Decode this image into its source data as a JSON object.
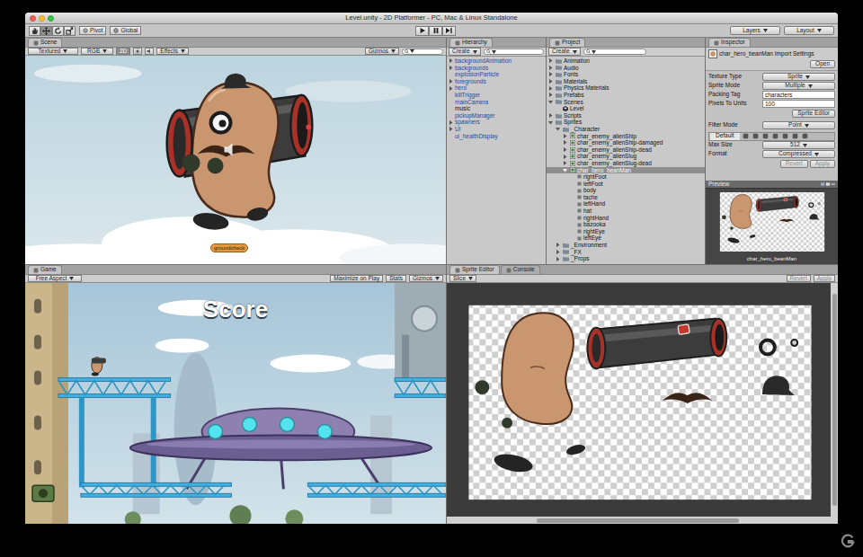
{
  "window": {
    "title": "Level.unity - 2D Platformer - PC, Mac & Linux Standalone"
  },
  "toolbar": {
    "tools": [
      {
        "kind": "hand",
        "selected": false
      },
      {
        "kind": "move",
        "selected": true
      },
      {
        "kind": "rotate",
        "selected": false
      },
      {
        "kind": "scale",
        "selected": false
      }
    ],
    "pivot": "Pivot",
    "global": "Global",
    "layers": "Layers",
    "layout": "Layout"
  },
  "scene": {
    "tab": {
      "label": "Scene",
      "selected": true
    },
    "shading": "Textured",
    "channel": "RGB",
    "mode2d": {
      "label": "2D",
      "on": true
    },
    "effects": "Effects",
    "gizmos": "Gizmos",
    "label": "groundcheck"
  },
  "hierarchy": {
    "tab": {
      "label": "Hierarchy",
      "selected": true
    },
    "create": "Create",
    "items": [
      {
        "name": "backgroundAnimation",
        "prefab": true,
        "expandable": true,
        "expanded": false
      },
      {
        "name": "backgrounds",
        "prefab": true,
        "expandable": true,
        "expanded": false
      },
      {
        "name": "explosionParticle",
        "prefab": true,
        "expandable": false,
        "expanded": false
      },
      {
        "name": "foregrounds",
        "prefab": true,
        "expandable": true,
        "expanded": false
      },
      {
        "name": "hero",
        "prefab": true,
        "expandable": true,
        "expanded": false
      },
      {
        "name": "killTrigger",
        "prefab": true,
        "expandable": false,
        "expanded": false
      },
      {
        "name": "mainCamera",
        "prefab": true,
        "expandable": false,
        "expanded": false
      },
      {
        "name": "music",
        "prefab": false,
        "expandable": false,
        "expanded": false
      },
      {
        "name": "pickupManager",
        "prefab": true,
        "expandable": false,
        "expanded": false
      },
      {
        "name": "spawners",
        "prefab": true,
        "expandable": true,
        "expanded": false
      },
      {
        "name": "UI",
        "prefab": true,
        "expandable": true,
        "expanded": false
      },
      {
        "name": "ui_healthDisplay",
        "prefab": true,
        "expandable": false,
        "expanded": false
      }
    ]
  },
  "project": {
    "tab": {
      "label": "Project",
      "selected": true
    },
    "create": "Create",
    "items": [
      {
        "name": "Animation",
        "depth": 0,
        "kind": "folder",
        "expandable": true,
        "expanded": false,
        "selected": false
      },
      {
        "name": "Audio",
        "depth": 0,
        "kind": "folder",
        "expandable": true,
        "expanded": false,
        "selected": false
      },
      {
        "name": "Fonts",
        "depth": 0,
        "kind": "folder",
        "expandable": true,
        "expanded": false,
        "selected": false
      },
      {
        "name": "Materials",
        "depth": 0,
        "kind": "folder",
        "expandable": true,
        "expanded": false,
        "selected": false
      },
      {
        "name": "Physics Materials",
        "depth": 0,
        "kind": "folder",
        "expandable": true,
        "expanded": false,
        "selected": false
      },
      {
        "name": "Prefabs",
        "depth": 0,
        "kind": "folder",
        "expandable": true,
        "expanded": false,
        "selected": false
      },
      {
        "name": "Scenes",
        "depth": 0,
        "kind": "folder",
        "expandable": true,
        "expanded": true,
        "selected": false
      },
      {
        "name": "Level",
        "depth": 1,
        "kind": "scene",
        "expandable": false,
        "expanded": false,
        "selected": false
      },
      {
        "name": "Scripts",
        "depth": 0,
        "kind": "folder",
        "expandable": true,
        "expanded": false,
        "selected": false
      },
      {
        "name": "Sprites",
        "depth": 0,
        "kind": "folder",
        "expandable": true,
        "expanded": true,
        "selected": false
      },
      {
        "name": "_Character",
        "depth": 1,
        "kind": "folder",
        "expandable": true,
        "expanded": true,
        "selected": false
      },
      {
        "name": "char_enemy_alienShip",
        "depth": 2,
        "kind": "sprite",
        "expandable": true,
        "expanded": false,
        "selected": false
      },
      {
        "name": "char_enemy_alienShip-damaged",
        "depth": 2,
        "kind": "sprite",
        "expandable": true,
        "expanded": false,
        "selected": false
      },
      {
        "name": "char_enemy_alienShip-dead",
        "depth": 2,
        "kind": "sprite",
        "expandable": true,
        "expanded": false,
        "selected": false
      },
      {
        "name": "char_enemy_alienSlug",
        "depth": 2,
        "kind": "sprite",
        "expandable": true,
        "expanded": false,
        "selected": false
      },
      {
        "name": "char_enemy_alienSlug-dead",
        "depth": 2,
        "kind": "sprite",
        "expandable": true,
        "expanded": false,
        "selected": false
      },
      {
        "name": "char_hero_beanMan",
        "depth": 2,
        "kind": "sprite",
        "expandable": true,
        "expanded": true,
        "selected": true
      },
      {
        "name": "rightFoot",
        "depth": 3,
        "kind": "subsprite",
        "expandable": false,
        "expanded": false,
        "selected": false
      },
      {
        "name": "leftFoot",
        "depth": 3,
        "kind": "subsprite",
        "expandable": false,
        "expanded": false,
        "selected": false
      },
      {
        "name": "body",
        "depth": 3,
        "kind": "subsprite",
        "expandable": false,
        "expanded": false,
        "selected": false
      },
      {
        "name": "tache",
        "depth": 3,
        "kind": "subsprite",
        "expandable": false,
        "expanded": false,
        "selected": false
      },
      {
        "name": "leftHand",
        "depth": 3,
        "kind": "subsprite",
        "expandable": false,
        "expanded": false,
        "selected": false
      },
      {
        "name": "hat",
        "depth": 3,
        "kind": "subsprite",
        "expandable": false,
        "expanded": false,
        "selected": false
      },
      {
        "name": "rightHand",
        "depth": 3,
        "kind": "subsprite",
        "expandable": false,
        "expanded": false,
        "selected": false
      },
      {
        "name": "bazooka",
        "depth": 3,
        "kind": "subsprite",
        "expandable": false,
        "expanded": false,
        "selected": false
      },
      {
        "name": "rightEye",
        "depth": 3,
        "kind": "subsprite",
        "expandable": false,
        "expanded": false,
        "selected": false
      },
      {
        "name": "leftEye",
        "depth": 3,
        "kind": "subsprite",
        "expandable": false,
        "expanded": false,
        "selected": false
      },
      {
        "name": "_Environment",
        "depth": 1,
        "kind": "folder",
        "expandable": true,
        "expanded": false,
        "selected": false
      },
      {
        "name": "_FX",
        "depth": 1,
        "kind": "folder",
        "expandable": true,
        "expanded": false,
        "selected": false
      },
      {
        "name": "_Props",
        "depth": 1,
        "kind": "folder",
        "expandable": true,
        "expanded": false,
        "selected": false
      }
    ]
  },
  "inspector": {
    "tab": {
      "label": "Inspector",
      "selected": true
    },
    "title": "char_hero_beanMan Import Settings",
    "open": "Open",
    "fields": [
      {
        "label": "Texture Type",
        "value": "Sprite",
        "kind": "dropdown"
      },
      {
        "label": "Sprite Mode",
        "value": "Multiple",
        "kind": "dropdown"
      },
      {
        "label": "Packing Tag",
        "value": "characters",
        "kind": "text"
      },
      {
        "label": "Pixels To Units",
        "value": "100",
        "kind": "text"
      }
    ],
    "sprite_editor_button": "Sprite Editor",
    "filter": {
      "label": "Filter Mode",
      "value": "Point"
    },
    "platform_tab": {
      "label": "Default",
      "selected": true
    },
    "platform_fields": [
      {
        "label": "Max Size",
        "value": "512"
      },
      {
        "label": "Format",
        "value": "Compressed"
      }
    ],
    "revert": {
      "label": "Revert",
      "disabled": true
    },
    "apply": {
      "label": "Apply",
      "disabled": true
    },
    "preview": {
      "label": "Preview",
      "caption": "char_hero_beanMan"
    }
  },
  "game": {
    "tab": {
      "label": "Game",
      "selected": true
    },
    "aspect": "Free Aspect",
    "maximize": "Maximize on Play",
    "stats": "Stats",
    "gizmos": "Gizmos",
    "score": "Score"
  },
  "sprite_editor": {
    "tabs": [
      {
        "label": "Sprite Editor",
        "selected": true
      },
      {
        "label": "Console",
        "selected": false
      }
    ],
    "slice": "Slice",
    "revert": {
      "label": "Revert",
      "disabled": true
    },
    "apply": {
      "label": "Apply",
      "disabled": true
    }
  }
}
